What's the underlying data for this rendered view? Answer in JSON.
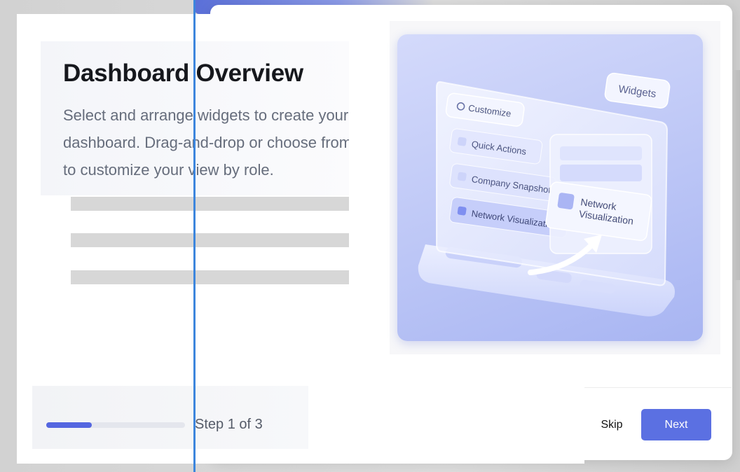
{
  "onboarding": {
    "title": "Dashboard Overview",
    "description": "Select and arrange widgets to create your dashboard. Drag-and-drop or choose from a list to customize your view by role.",
    "progress": {
      "label": "Step 1 of 3",
      "current_step": 1,
      "total_steps": 3,
      "fraction": 0.33
    },
    "buttons": {
      "skip_label": "Skip",
      "next_label": "Next"
    }
  },
  "illustration": {
    "widgets_chip": "Widgets",
    "customize_chip": "Customize",
    "items": [
      "Quick Actions",
      "Company Snapshot",
      "Network Visualization"
    ],
    "dragged_card_label": "Network Visualization"
  },
  "colors": {
    "accent": "#5b70e2",
    "progress_fill": "#5466e0",
    "divider": "#3d86dd",
    "title_text": "#16181d",
    "body_text": "#666d7c"
  }
}
